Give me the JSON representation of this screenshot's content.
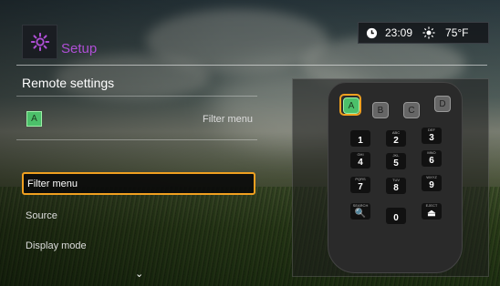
{
  "header": {
    "title": "Setup",
    "icon": "gear-icon"
  },
  "status": {
    "time": "23:09",
    "temperature": "75°F",
    "clock_icon": "clock-icon",
    "weather_icon": "sun-icon"
  },
  "section": {
    "title": "Remote settings"
  },
  "option": {
    "key_label": "A",
    "label": "Filter menu"
  },
  "menu": {
    "items": [
      {
        "label": "Filter menu",
        "selected": true
      },
      {
        "label": "Source",
        "selected": false
      },
      {
        "label": "Display mode",
        "selected": false
      }
    ],
    "more_icon": "⌄"
  },
  "remote": {
    "color_buttons": [
      "A",
      "B",
      "C",
      "D"
    ],
    "keys": [
      {
        "sub": "",
        "main": "1"
      },
      {
        "sub": "ABC",
        "main": "2"
      },
      {
        "sub": "DEF",
        "main": "3"
      },
      {
        "sub": "GHI",
        "main": "4"
      },
      {
        "sub": "JKL",
        "main": "5"
      },
      {
        "sub": "MNO",
        "main": "6"
      },
      {
        "sub": "PQRS",
        "main": "7"
      },
      {
        "sub": "TUV",
        "main": "8"
      },
      {
        "sub": "WXYZ",
        "main": "9"
      },
      {
        "sub": "SEARCH",
        "main": "🔍"
      },
      {
        "sub": "",
        "main": "0"
      },
      {
        "sub": "EJECT",
        "main": "⏏"
      }
    ]
  },
  "colors": {
    "accent": "#f0a020",
    "title": "#b04fd6",
    "green_key": "#4cc06a"
  }
}
